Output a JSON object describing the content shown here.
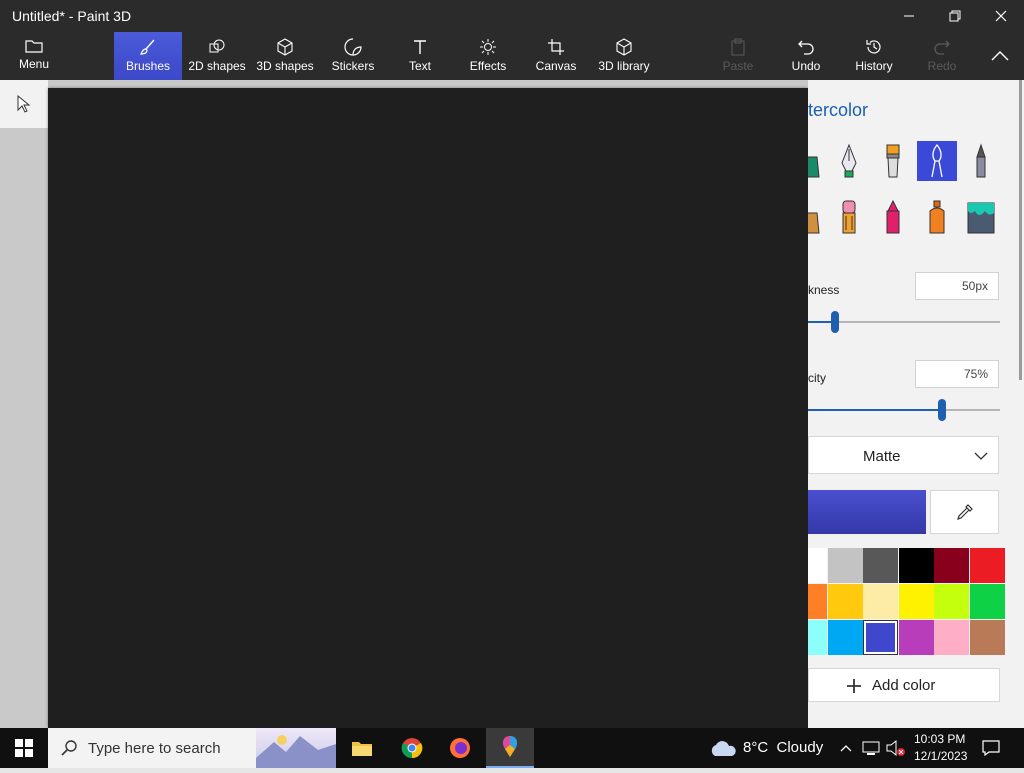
{
  "window": {
    "title": "Untitled* - Paint 3D"
  },
  "ribbon": {
    "menu": "Menu",
    "tabs": [
      "Brushes",
      "2D shapes",
      "3D shapes",
      "Stickers",
      "Text",
      "Effects",
      "Canvas",
      "3D library"
    ],
    "selected_tab": "Brushes",
    "paste": "Paste",
    "undo": "Undo",
    "history": "History",
    "redo": "Redo"
  },
  "panel": {
    "title_partial": "tercolor",
    "thickness_label_partial": "kness",
    "thickness_value": "50px",
    "thickness_level": 0.14,
    "opacity_label_partial": "city",
    "opacity_value": "75%",
    "opacity_level": 0.7,
    "finish": "Matte",
    "selected_color": "#4a4fcf",
    "palette": [
      [
        "#ffffff",
        "#c3c3c3",
        "#585858",
        "#000000",
        "#88001b",
        "#ec1c24"
      ],
      [
        "#ff7f27",
        "#ffc90e",
        "#fdeca6",
        "#fff200",
        "#c4ff0e",
        "#0ed145"
      ],
      [
        "#8cfffb",
        "#00a8f3",
        "#3f48cc",
        "#b83dba",
        "#ffaec8",
        "#b97a57"
      ]
    ],
    "add_color": "Add color"
  },
  "taskbar": {
    "search_placeholder": "Type here to search",
    "weather": "8°C  Cloudy",
    "time": "10:03 PM",
    "date": "12/1/2023"
  }
}
